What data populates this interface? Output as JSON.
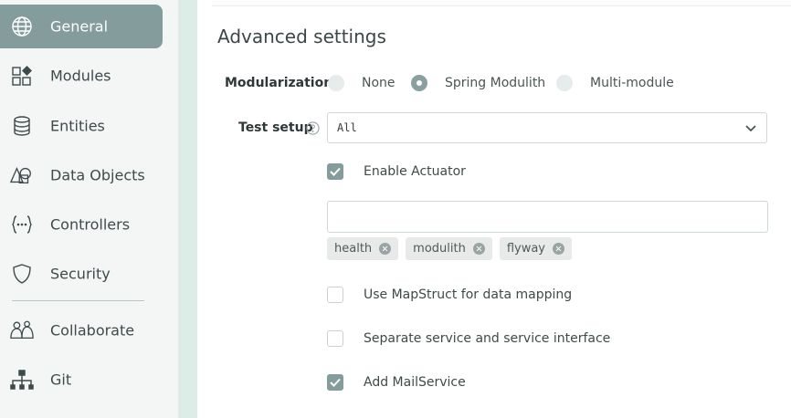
{
  "sidebar": {
    "items": [
      {
        "label": "General",
        "icon": "globe-icon",
        "active": true
      },
      {
        "label": "Modules",
        "icon": "modules-icon"
      },
      {
        "label": "Entities",
        "icon": "database-icon"
      },
      {
        "label": "Data Objects",
        "icon": "shapes-icon"
      },
      {
        "label": "Controllers",
        "icon": "braces-icon"
      },
      {
        "label": "Security",
        "icon": "shield-icon"
      },
      {
        "label": "Collaborate",
        "icon": "people-icon"
      },
      {
        "label": "Git",
        "icon": "git-tree-icon"
      }
    ]
  },
  "main": {
    "section_title": "Advanced settings",
    "modularization": {
      "label": "Modularization",
      "options": [
        "None",
        "Spring Modulith",
        "Multi-module"
      ],
      "selected": "Spring Modulith"
    },
    "test_setup": {
      "label": "Test setup",
      "value": "All"
    },
    "enable_actuator": {
      "label": "Enable Actuator",
      "checked": true
    },
    "actuator_input": {
      "value": ""
    },
    "actuator_tags": [
      "health",
      "modulith",
      "flyway"
    ],
    "mapstruct": {
      "label": "Use MapStruct for data mapping",
      "checked": false
    },
    "separate_service": {
      "label": "Separate service and service interface",
      "checked": false
    },
    "mail_service": {
      "label": "Add MailService",
      "checked": true
    }
  },
  "colors": {
    "accent": "#849c9c",
    "sidebar_bg": "#f4f5f5",
    "gutter_bg": "#deece8"
  }
}
